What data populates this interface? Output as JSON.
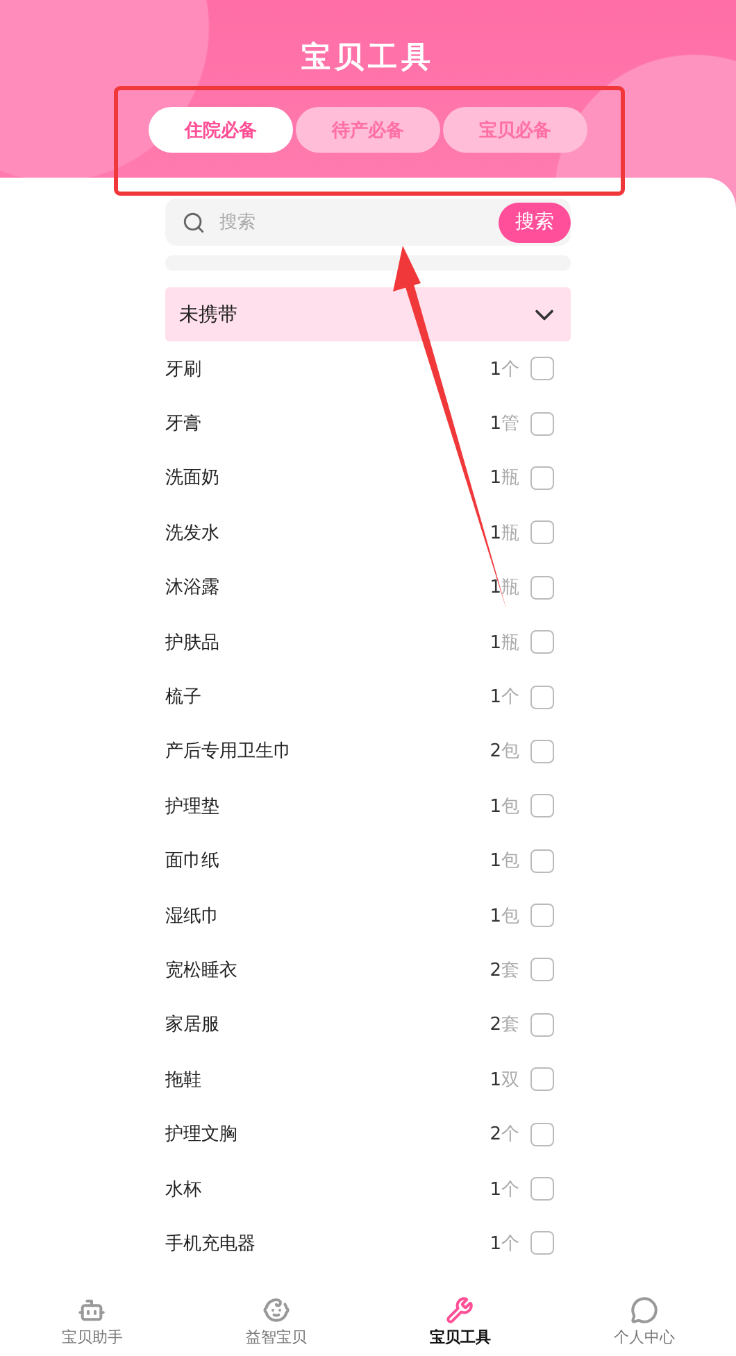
{
  "header": {
    "title": "宝贝工具"
  },
  "tabs": [
    {
      "label": "住院必备",
      "selected": true
    },
    {
      "label": "待产必备",
      "selected": false
    },
    {
      "label": "宝贝必备",
      "selected": false
    }
  ],
  "search": {
    "placeholder": "搜索",
    "button": "搜索"
  },
  "filter": {
    "label": "未携带",
    "expanded": false
  },
  "items": [
    {
      "name": "牙刷",
      "count": "1",
      "unit": "个",
      "checked": false
    },
    {
      "name": "牙膏",
      "count": "1",
      "unit": "管",
      "checked": false
    },
    {
      "name": "洗面奶",
      "count": "1",
      "unit": "瓶",
      "checked": false
    },
    {
      "name": "洗发水",
      "count": "1",
      "unit": "瓶",
      "checked": false
    },
    {
      "name": "沐浴露",
      "count": "1",
      "unit": "瓶",
      "checked": false
    },
    {
      "name": "护肤品",
      "count": "1",
      "unit": "瓶",
      "checked": false
    },
    {
      "name": "梳子",
      "count": "1",
      "unit": "个",
      "checked": false
    },
    {
      "name": "产后专用卫生巾",
      "count": "2",
      "unit": "包",
      "checked": false
    },
    {
      "name": "护理垫",
      "count": "1",
      "unit": "包",
      "checked": false
    },
    {
      "name": "面巾纸",
      "count": "1",
      "unit": "包",
      "checked": false
    },
    {
      "name": "湿纸巾",
      "count": "1",
      "unit": "包",
      "checked": false
    },
    {
      "name": "宽松睡衣",
      "count": "2",
      "unit": "套",
      "checked": false
    },
    {
      "name": "家居服",
      "count": "2",
      "unit": "套",
      "checked": false
    },
    {
      "name": "拖鞋",
      "count": "1",
      "unit": "双",
      "checked": false
    },
    {
      "name": "护理文胸",
      "count": "2",
      "unit": "个",
      "checked": false
    },
    {
      "name": "水杯",
      "count": "1",
      "unit": "个",
      "checked": false
    },
    {
      "name": "手机充电器",
      "count": "1",
      "unit": "个",
      "checked": false
    }
  ],
  "bottom_nav": [
    {
      "label": "宝贝助手",
      "selected": false
    },
    {
      "label": "益智宝贝",
      "selected": false
    },
    {
      "label": "宝贝工具",
      "selected": true
    },
    {
      "label": "个人中心",
      "selected": false
    }
  ]
}
